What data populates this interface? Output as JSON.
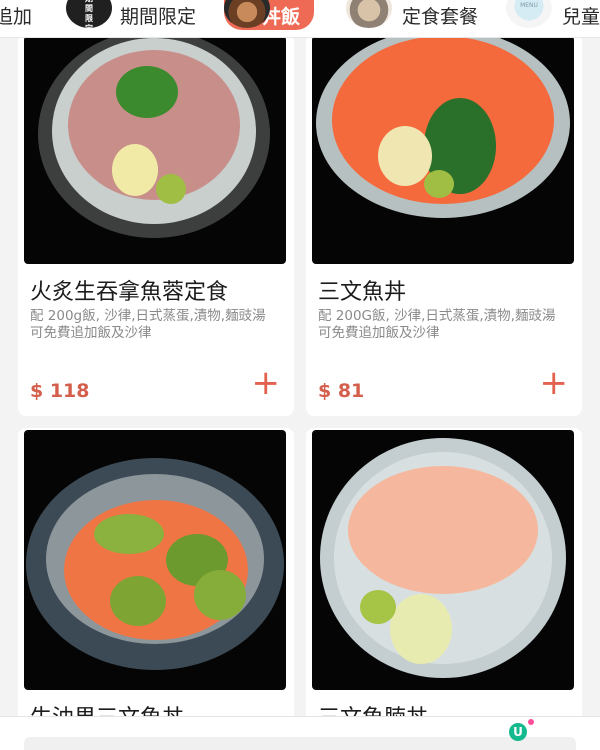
{
  "tabs": [
    {
      "label": "追加",
      "icon": "none"
    },
    {
      "label": "期間限定",
      "thumb_text": "期間限定",
      "icon": "limited-time-thumbnail"
    },
    {
      "label": "丼飯",
      "icon": "rice-bowl-thumbnail",
      "active": true
    },
    {
      "label": "定食套餐",
      "icon": "set-meal-thumbnail"
    },
    {
      "label": "兒童",
      "thumb_caption": "MENU",
      "icon": "kids-menu-thumbnail"
    }
  ],
  "items": [
    {
      "title": "火炙生吞拿魚蓉定食",
      "desc": "配 200g飯, 沙律,日式蒸蛋,漬物,麵豉湯 可免費追加飯及沙律",
      "price": "$ 118"
    },
    {
      "title": "三文魚丼",
      "desc": "配 200G飯, 沙律,日式蒸蛋,漬物,麵豉湯 可免費追加飯及沙律",
      "price": "$ 81"
    },
    {
      "title": "牛油果三文魚丼"
    },
    {
      "title": "三文魚腩丼"
    }
  ],
  "actions": {
    "add_symbol": "+"
  },
  "overlay": {
    "logo_letter": "U"
  },
  "colors": {
    "accent": "#ef6a55",
    "price": "#d45f4c",
    "background": "#f3f3f3",
    "logo": "#15b98e"
  }
}
